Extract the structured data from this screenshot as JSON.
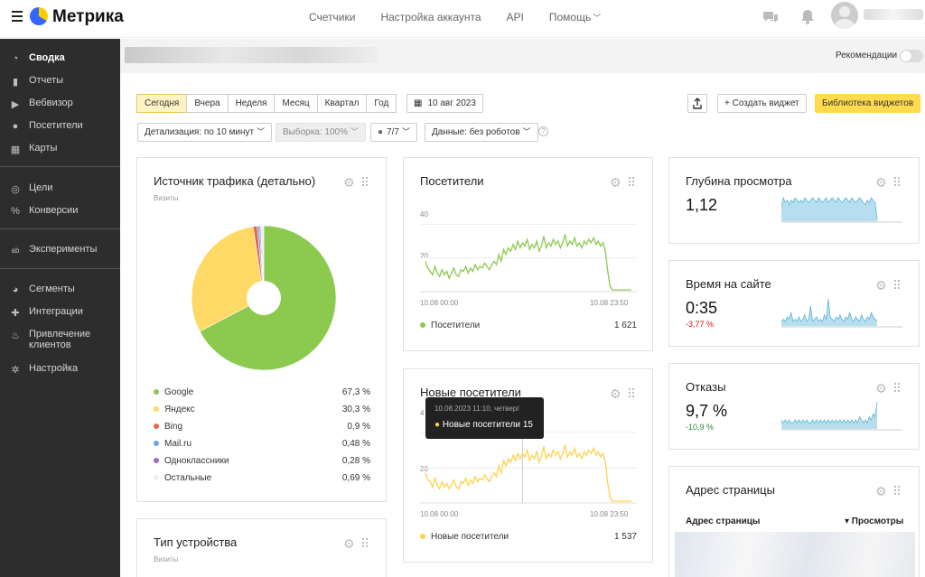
{
  "app": {
    "name": "Метрика"
  },
  "topnav": [
    "Счетчики",
    "Настройка аккаунта",
    "API",
    "Помощь"
  ],
  "sidebar": [
    {
      "label": "Сводка",
      "icon": "gauge-icon",
      "active": true
    },
    {
      "label": "Отчеты",
      "icon": "bar-chart-icon"
    },
    {
      "label": "Вебвизор",
      "icon": "play-icon"
    },
    {
      "label": "Посетители",
      "icon": "person-icon"
    },
    {
      "label": "Карты",
      "icon": "map-icon"
    },
    {
      "label": "Цели",
      "icon": "target-icon"
    },
    {
      "label": "Конверсии",
      "icon": "percent-icon"
    },
    {
      "label": "Эксперименты",
      "icon": "ab-icon"
    },
    {
      "label": "Сегменты",
      "icon": "pie-icon"
    },
    {
      "label": "Интеграции",
      "icon": "puzzle-icon"
    },
    {
      "label": "Привлечение клиентов",
      "icon": "flame-icon"
    },
    {
      "label": "Настройка",
      "icon": "gear-icon"
    }
  ],
  "strip": {
    "recommendations": "Рекомендации"
  },
  "periods": [
    "Сегодня",
    "Вчера",
    "Неделя",
    "Месяц",
    "Квартал",
    "Год"
  ],
  "active_period": "Сегодня",
  "date": "10 авг 2023",
  "toolbar": {
    "create_widget": "+ Создать виджет",
    "library": "Библиотека виджетов",
    "detail": "Детализация: по 10 минут",
    "sample": "Выборка: 100%",
    "comments": "7/7",
    "data_filter": "Данные: без роботов"
  },
  "traffic": {
    "title": "Источник трафика (детально)",
    "subtitle": "Визиты",
    "items": [
      {
        "name": "Google",
        "value": "67,3 %",
        "color": "#8cc94f"
      },
      {
        "name": "Яндекс",
        "value": "30,3 %",
        "color": "#ffd966"
      },
      {
        "name": "Bing",
        "value": "0,9 %",
        "color": "#e8644f"
      },
      {
        "name": "Mail.ru",
        "value": "0,48 %",
        "color": "#6aa3e8"
      },
      {
        "name": "Одноклассники",
        "value": "0,28 %",
        "color": "#9c6ac7"
      },
      {
        "name": "Остальные",
        "value": "0,69 %",
        "color": "#eeeeee"
      }
    ]
  },
  "chart_data": [
    {
      "type": "pie",
      "title": "Источник трафика (детально)",
      "categories": [
        "Google",
        "Яндекс",
        "Bing",
        "Mail.ru",
        "Одноклассники",
        "Остальные"
      ],
      "values": [
        67.3,
        30.3,
        0.9,
        0.48,
        0.28,
        0.69
      ]
    },
    {
      "type": "line",
      "title": "Посетители",
      "x": [
        "10.08 00:00",
        "10.08 23:50"
      ],
      "ylim": [
        0,
        45
      ],
      "yticks": [
        20,
        40
      ],
      "series": [
        {
          "name": "Посетители",
          "color": "#8cc94f",
          "values": [
            18,
            14,
            12,
            10,
            15,
            11,
            9,
            13,
            10,
            12,
            8,
            11,
            14,
            10,
            9,
            13,
            12,
            15,
            11,
            14,
            12,
            16,
            13,
            15,
            14,
            17,
            15,
            13,
            16,
            18,
            16,
            22,
            18,
            25,
            22,
            26,
            24,
            28,
            25,
            30,
            26,
            29,
            27,
            31,
            25,
            28,
            26,
            30,
            24,
            27,
            33,
            26,
            29,
            27,
            31,
            28,
            30,
            26,
            29,
            34,
            27,
            30,
            28,
            32,
            27,
            29,
            26,
            30,
            28,
            31,
            29,
            32,
            28,
            30,
            27,
            29,
            24,
            12,
            3,
            1,
            1,
            1,
            1,
            1,
            1,
            1,
            1,
            1
          ]
        }
      ],
      "total": "1 621"
    },
    {
      "type": "line",
      "title": "Новые посетители",
      "x": [
        "10.08 00:00",
        "10.08 23:50"
      ],
      "ylim": [
        0,
        45
      ],
      "yticks": [
        20,
        40
      ],
      "series": [
        {
          "name": "Новые посетители",
          "color": "#ffd24d",
          "values": [
            17,
            13,
            12,
            9,
            14,
            10,
            8,
            12,
            9,
            11,
            8,
            10,
            13,
            9,
            8,
            12,
            11,
            14,
            10,
            13,
            11,
            15,
            12,
            14,
            13,
            16,
            14,
            12,
            15,
            17,
            15,
            21,
            17,
            24,
            21,
            25,
            23,
            27,
            24,
            28,
            25,
            28,
            26,
            30,
            24,
            27,
            25,
            29,
            23,
            26,
            32,
            25,
            28,
            26,
            30,
            27,
            29,
            25,
            28,
            33,
            26,
            29,
            27,
            31,
            26,
            28,
            25,
            29,
            27,
            30,
            28,
            31,
            27,
            29,
            26,
            28,
            23,
            11,
            3,
            1,
            1,
            1,
            1,
            1,
            1,
            1,
            1,
            1
          ]
        }
      ],
      "total": "1 537"
    },
    {
      "type": "area",
      "title": "Глубина просмотра",
      "series": [
        {
          "name": "Глубина просмотра",
          "color": "#9fd3e8",
          "values": [
            6,
            10,
            8,
            9,
            7,
            9,
            8,
            10,
            9,
            8,
            9,
            8,
            10,
            9,
            8,
            9,
            10,
            9,
            8,
            10,
            9,
            8,
            9,
            10,
            8,
            9,
            10,
            9,
            8,
            10,
            9,
            8,
            9,
            10,
            9,
            8,
            10,
            9,
            8,
            9,
            10,
            9,
            8,
            7,
            9,
            8,
            10,
            9,
            8,
            1
          ]
        }
      ]
    },
    {
      "type": "area",
      "title": "Время на сайте",
      "series": [
        {
          "name": "Время на сайте",
          "color": "#9fd3e8",
          "values": [
            2,
            3,
            2,
            4,
            3,
            6,
            2,
            3,
            2,
            4,
            2,
            3,
            5,
            2,
            3,
            9,
            2,
            3,
            4,
            2,
            3,
            2,
            5,
            3,
            12,
            4,
            3,
            2,
            4,
            3,
            5,
            3,
            2,
            4,
            3,
            6,
            3,
            2,
            4,
            3,
            2,
            5,
            3,
            2,
            4,
            3,
            6,
            4,
            3,
            2
          ]
        }
      ]
    },
    {
      "type": "area",
      "title": "Отказы",
      "series": [
        {
          "name": "Отказы",
          "color": "#9fd3e8",
          "values": [
            3,
            2,
            3,
            2,
            3,
            2,
            2,
            3,
            2,
            3,
            2,
            3,
            2,
            3,
            2,
            2,
            3,
            2,
            3,
            2,
            3,
            2,
            3,
            2,
            3,
            2,
            3,
            2,
            3,
            2,
            3,
            2,
            3,
            2,
            3,
            2,
            3,
            2,
            3,
            2,
            4,
            3,
            2,
            3,
            2,
            4,
            3,
            5,
            4,
            9
          ]
        }
      ]
    }
  ],
  "visitors": {
    "title": "Посетители",
    "legend": "Посетители",
    "total": "1 621",
    "y20": "20",
    "y40": "40",
    "x_start": "10.08 00:00",
    "x_end": "10.08 23:50"
  },
  "new_visitors": {
    "title": "Новые посетители",
    "legend": "Новые посетители",
    "total": "1 537",
    "y20": "20",
    "y40": "4",
    "x_start": "10.08 00:00",
    "x_end": "10.08 23:50",
    "tooltip": {
      "date": "10.08.2023 11:10, четверг",
      "label": "Новые посетители",
      "value": "15"
    }
  },
  "depth": {
    "title": "Глубина просмотра",
    "value": "1,12"
  },
  "time": {
    "title": "Время на сайте",
    "value": "0:35",
    "delta": "-3,77 %"
  },
  "bounce": {
    "title": "Отказы",
    "value": "9,7 %",
    "delta": "-10,9 %"
  },
  "address": {
    "title": "Адрес страницы",
    "col": "Адрес страницы",
    "sort": "▾ Просмотры"
  },
  "device": {
    "title": "Тип устройства",
    "subtitle": "Визиты"
  }
}
